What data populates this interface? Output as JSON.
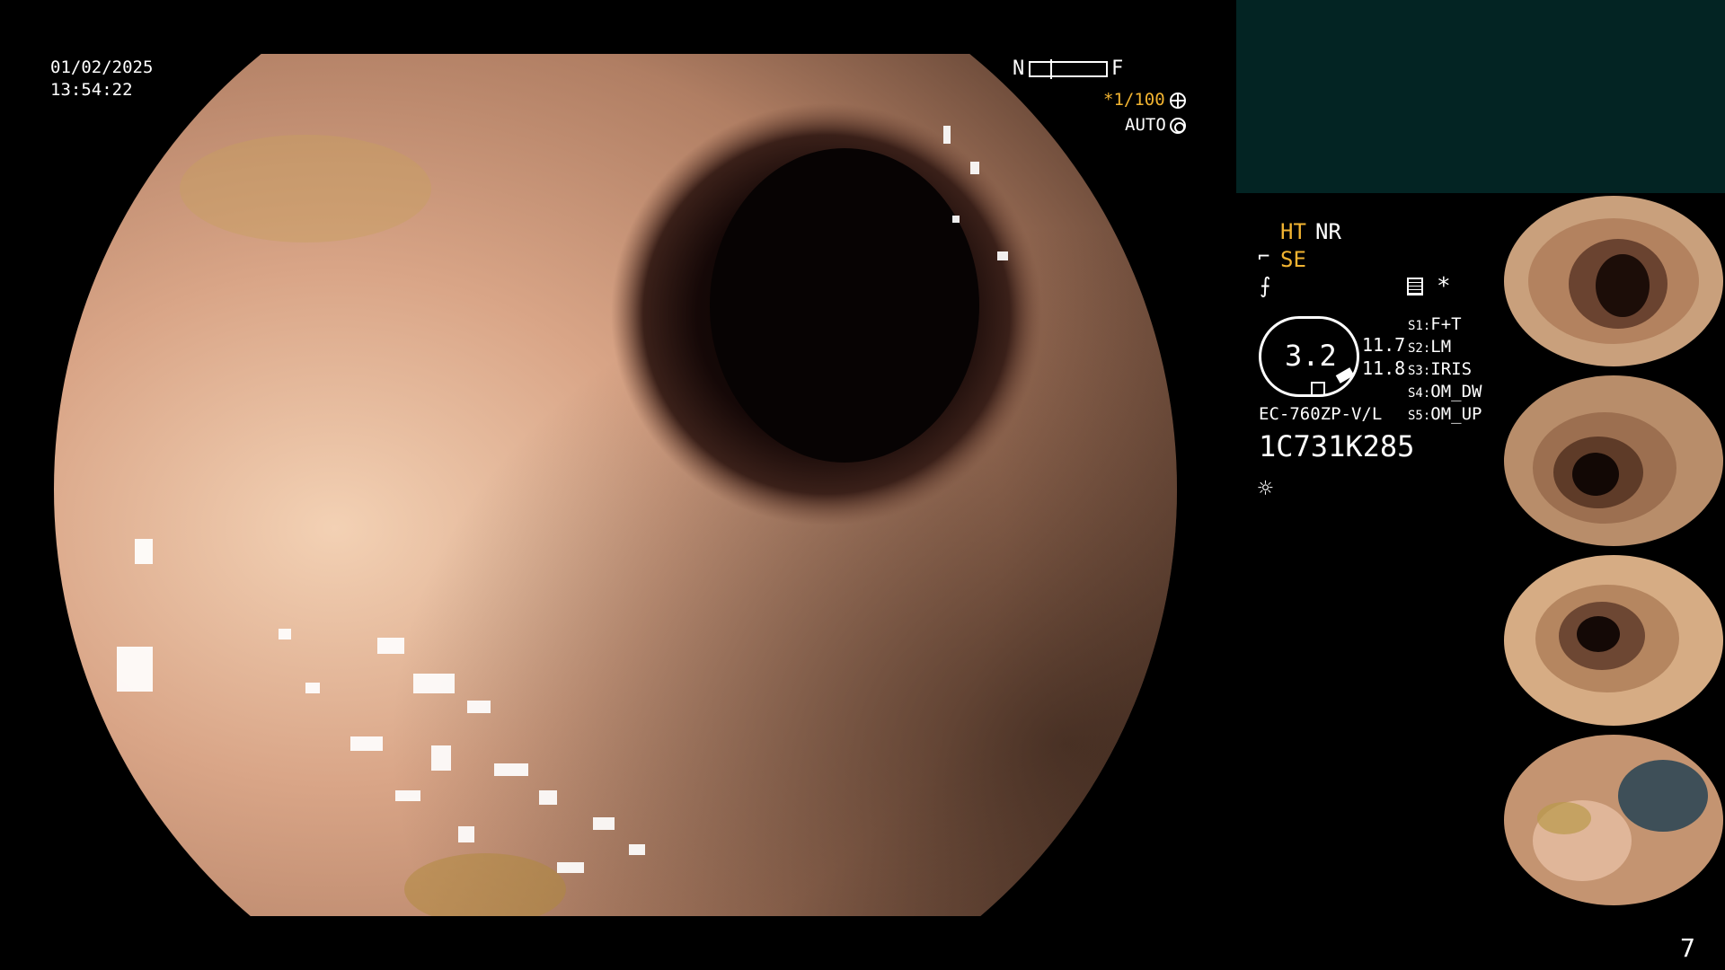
{
  "datetime": {
    "date": "01/02/2025",
    "time": "13:54:22"
  },
  "focus": {
    "near": "N",
    "far": "F"
  },
  "shutter": {
    "asterisk": "*",
    "value": "1/100"
  },
  "iris_mode": "AUTO",
  "modes": {
    "ht": "HT",
    "nr": "NR",
    "se": "SE"
  },
  "magnification": "3.2",
  "readouts": {
    "r1": "11.7",
    "r2": "11.8"
  },
  "snapshot_star": "*",
  "switches": [
    {
      "key": "S1",
      "value": "F+T"
    },
    {
      "key": "S2",
      "value": "LM"
    },
    {
      "key": "S3",
      "value": "IRIS"
    },
    {
      "key": "S4",
      "value": "OM_DW"
    },
    {
      "key": "S5",
      "value": "OM_UP"
    }
  ],
  "scope_model": "EC-760ZP-V/L",
  "scope_serial": "1C731K285",
  "page_number": "7",
  "colors": {
    "overlay_yellow": "#f2b431",
    "panel_teal": "#032423",
    "background": "#000000"
  }
}
